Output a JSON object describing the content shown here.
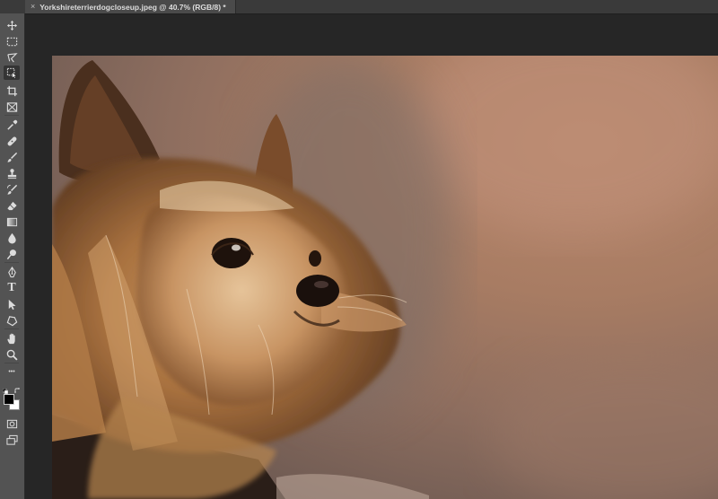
{
  "document_tab": {
    "close_glyph": "×",
    "title": "Yorkshireterrierdogcloseup.jpeg @ 40.7% (RGB/8) *"
  },
  "toolbar": {
    "tools": [
      {
        "name": "move-tool",
        "icon": "move-icon"
      },
      {
        "name": "marquee-tool",
        "icon": "marquee-icon"
      },
      {
        "name": "lasso-tool",
        "icon": "lasso-icon"
      },
      {
        "name": "object-selection-tool",
        "icon": "object-selection-icon",
        "active": true
      },
      {
        "name": "crop-tool",
        "icon": "crop-icon"
      },
      {
        "name": "frame-tool",
        "icon": "frame-icon"
      },
      {
        "name": "eyedropper-tool",
        "icon": "eyedropper-icon"
      },
      {
        "name": "healing-brush-tool",
        "icon": "bandage-icon"
      },
      {
        "name": "brush-tool",
        "icon": "brush-icon"
      },
      {
        "name": "clone-stamp-tool",
        "icon": "stamp-icon"
      },
      {
        "name": "history-brush-tool",
        "icon": "history-brush-icon"
      },
      {
        "name": "eraser-tool",
        "icon": "eraser-icon"
      },
      {
        "name": "gradient-tool",
        "icon": "gradient-icon"
      },
      {
        "name": "blur-tool",
        "icon": "droplet-icon"
      },
      {
        "name": "dodge-tool",
        "icon": "dodge-icon"
      },
      {
        "name": "pen-tool",
        "icon": "pen-icon"
      },
      {
        "name": "type-tool",
        "icon": "type-icon"
      },
      {
        "name": "path-selection-tool",
        "icon": "arrow-icon"
      },
      {
        "name": "shape-tool",
        "icon": "shape-icon"
      },
      {
        "name": "hand-tool",
        "icon": "hand-icon"
      },
      {
        "name": "zoom-tool",
        "icon": "zoom-icon"
      },
      {
        "name": "edit-toolbar",
        "icon": "ellipsis-icon"
      }
    ],
    "type_glyph": "T",
    "ellipsis_glyph": "•••",
    "foreground_color": "#000000",
    "background_color": "#ffffff"
  },
  "canvas": {
    "image_description_icon": "yorkshire-terrier-photo"
  },
  "colors": {
    "toolbar_bg": "#535353",
    "workspace_bg": "#262626",
    "tab_active_bg": "#4a4a4a"
  }
}
